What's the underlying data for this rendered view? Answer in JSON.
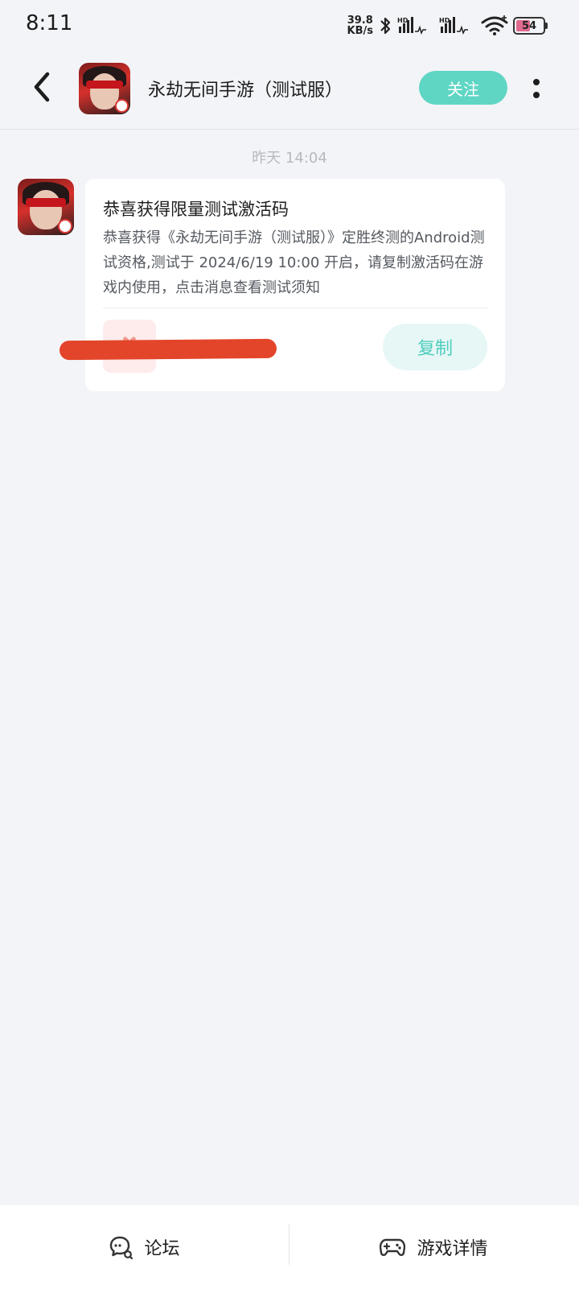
{
  "status_bar": {
    "time": "8:11",
    "net_speed_value": "39.8",
    "net_speed_unit": "KB/s",
    "battery": "54",
    "battery_level_percent": 54,
    "icons": [
      "bluetooth-icon",
      "signal-hd-icon",
      "signal-hd-icon",
      "wifi-icon",
      "battery-icon"
    ]
  },
  "header": {
    "title": "永劫无间手游（测试服）",
    "follow_label": "关注",
    "icons": {
      "back": "chevron-left-icon",
      "more": "more-vertical-icon"
    }
  },
  "chat": {
    "timestamp": "昨天  14:04",
    "message": {
      "title": "恭喜获得限量测试激活码",
      "body": "恭喜获得《永劫无间手游（测试服）》定胜终测的Android测试资格,测试于 2024/6/19 10:00 开启，请复制激活码在游戏内使用，点击消息查看测试须知",
      "copy_label": "复制",
      "gift_icon": "gift-icon"
    }
  },
  "bottom_bar": {
    "forum_label": "论坛",
    "game_detail_label": "游戏详情",
    "icons": {
      "forum": "chat-bubble-icon",
      "game_detail": "gamepad-icon"
    }
  },
  "colors": {
    "accent": "#5fd6c4",
    "copy_text": "#4fcdbc",
    "copy_bg": "#e6f7f6",
    "background": "#f3f4f7",
    "redaction": "#e3452a"
  }
}
